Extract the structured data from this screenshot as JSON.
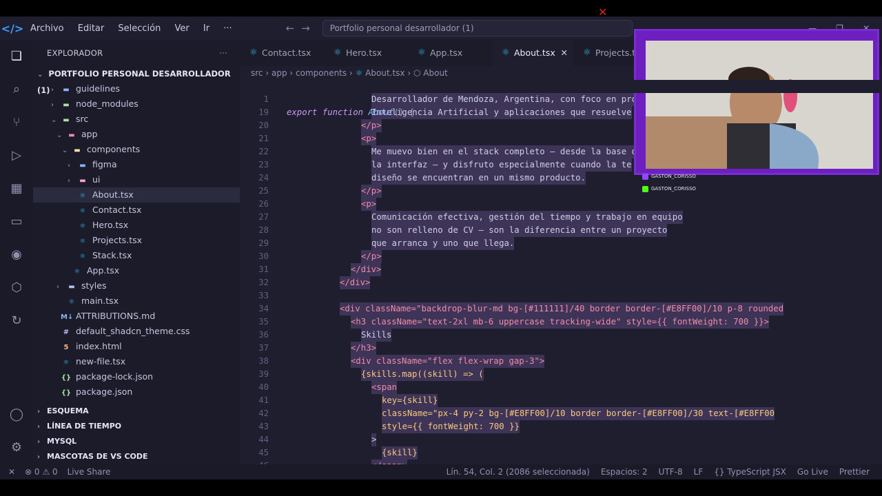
{
  "titlebar": {
    "menu": [
      "Archivo",
      "Editar",
      "Selección",
      "Ver",
      "Ir",
      "···"
    ],
    "search": "Portfolio personal desarrollador (1)",
    "record_icon": "✕"
  },
  "explorer": {
    "title": "EXPLORADOR",
    "project": "PORTFOLIO PERSONAL DESARROLLADOR (1)",
    "items": [
      {
        "label": "guidelines",
        "icon": "folder-icon",
        "color": "#89b4fa",
        "depth": 1,
        "chev": "›"
      },
      {
        "label": "node_modules",
        "icon": "folder-icon",
        "color": "#a6e3a1",
        "depth": 1,
        "chev": "›"
      },
      {
        "label": "src",
        "icon": "folder-open-icon",
        "color": "#a6e3a1",
        "depth": 1,
        "chev": "⌄"
      },
      {
        "label": "app",
        "icon": "folder-open-icon",
        "color": "#f38ba8",
        "depth": 2,
        "chev": "⌄"
      },
      {
        "label": "components",
        "icon": "folder-open-icon",
        "color": "#f9e2af",
        "depth": 3,
        "chev": "⌄"
      },
      {
        "label": "figma",
        "icon": "folder-icon",
        "color": "#89b4fa",
        "depth": 4,
        "chev": "›"
      },
      {
        "label": "ui",
        "icon": "folder-icon",
        "color": "#f5a3d4",
        "depth": 4,
        "chev": "›"
      },
      {
        "label": "About.tsx",
        "icon": "react-icon",
        "color": "#2fb5e0",
        "depth": 4,
        "chev": ""
      },
      {
        "label": "Contact.tsx",
        "icon": "react-icon",
        "color": "#2fb5e0",
        "depth": 4,
        "chev": ""
      },
      {
        "label": "Hero.tsx",
        "icon": "react-icon",
        "color": "#2fb5e0",
        "depth": 4,
        "chev": ""
      },
      {
        "label": "Projects.tsx",
        "icon": "react-icon",
        "color": "#2fb5e0",
        "depth": 4,
        "chev": ""
      },
      {
        "label": "Stack.tsx",
        "icon": "react-icon",
        "color": "#2fb5e0",
        "depth": 4,
        "chev": ""
      },
      {
        "label": "App.tsx",
        "icon": "react-icon",
        "color": "#2fb5e0",
        "depth": 3,
        "chev": ""
      },
      {
        "label": "styles",
        "icon": "folder-icon",
        "color": "#b4befe",
        "depth": 2,
        "chev": "›"
      },
      {
        "label": "main.tsx",
        "icon": "react-icon",
        "color": "#2fb5e0",
        "depth": 2,
        "chev": ""
      },
      {
        "label": "ATTRIBUTIONS.md",
        "icon": "markdown-icon",
        "color": "#89b4fa",
        "depth": 1,
        "chev": ""
      },
      {
        "label": "default_shadcn_theme.css",
        "icon": "css-icon",
        "color": "#b4befe",
        "depth": 1,
        "chev": ""
      },
      {
        "label": "index.html",
        "icon": "html-icon",
        "color": "#fab387",
        "depth": 1,
        "chev": ""
      },
      {
        "label": "new-file.tsx",
        "icon": "react-icon",
        "color": "#2fb5e0",
        "depth": 1,
        "chev": ""
      },
      {
        "label": "package-lock.json",
        "icon": "json-icon",
        "color": "#a6e3a1",
        "depth": 1,
        "chev": ""
      },
      {
        "label": "package.json",
        "icon": "json-icon",
        "color": "#a6e3a1",
        "depth": 1,
        "chev": ""
      }
    ],
    "selected": "About.tsx",
    "sections": [
      "ESQUEMA",
      "LÍNEA DE TIEMPO",
      "MYSQL",
      "MASCOTAS DE VS CODE"
    ]
  },
  "tabs": [
    {
      "label": "Contact.tsx",
      "active": false
    },
    {
      "label": "Hero.tsx",
      "active": false
    },
    {
      "label": "App.tsx",
      "active": false
    },
    {
      "label": "About.tsx",
      "active": true
    },
    {
      "label": "Projects.ts",
      "active": false
    }
  ],
  "breadcrumb": [
    "src",
    "app",
    "components",
    "About.tsx",
    "About"
  ],
  "sticky": {
    "ln": "1",
    "text": "export function About() {"
  },
  "code": [
    {
      "ln": "",
      "text": "Desarrollador de Mendoza, Argentina, con foco en pro"
    },
    {
      "ln": "19",
      "text": "Inteligencia Artificial y aplicaciones que resuelve"
    },
    {
      "ln": "20",
      "text": "</p>"
    },
    {
      "ln": "21",
      "text": "<p>"
    },
    {
      "ln": "22",
      "text": "Me muevo bien en el stack completo — desde la base d"
    },
    {
      "ln": "23",
      "text": "la interfaz — y disfruto especialmente cuando la te"
    },
    {
      "ln": "24",
      "text": "diseño se encuentran en un mismo producto."
    },
    {
      "ln": "25",
      "text": "</p>"
    },
    {
      "ln": "26",
      "text": "<p>"
    },
    {
      "ln": "27",
      "text": "Comunicación efectiva, gestión del tiempo y trabajo en equipo"
    },
    {
      "ln": "28",
      "text": "no son relleno de CV — son la diferencia entre un proyecto"
    },
    {
      "ln": "29",
      "text": "que arranca y uno que llega."
    },
    {
      "ln": "30",
      "text": "</p>"
    },
    {
      "ln": "31",
      "text": "</div>"
    },
    {
      "ln": "32",
      "text": "</div>"
    },
    {
      "ln": "33",
      "text": ""
    },
    {
      "ln": "34",
      "text": "<div className=\"backdrop-blur-md bg-[#111111]/40 border border-[#E8FF00]/10 p-8 rounded"
    },
    {
      "ln": "35",
      "text": "<h3 className=\"text-2xl mb-6 uppercase tracking-wide\" style={{ fontWeight: 700 }}>"
    },
    {
      "ln": "36",
      "text": "Skills"
    },
    {
      "ln": "37",
      "text": "</h3>"
    },
    {
      "ln": "38",
      "text": "<div className=\"flex flex-wrap gap-3\">"
    },
    {
      "ln": "39",
      "text": "{skills.map((skill) => ("
    },
    {
      "ln": "40",
      "text": "<span"
    },
    {
      "ln": "41",
      "text": "key={skill}"
    },
    {
      "ln": "42",
      "text": "className=\"px-4 py-2 bg-[#E8FF00]/10 border border-[#E8FF00]/30 text-[#E8FF00"
    },
    {
      "ln": "43",
      "text": "style={{ fontWeight: 700 }}"
    },
    {
      "ln": "44",
      "text": ">"
    },
    {
      "ln": "45",
      "text": "{skill}"
    },
    {
      "ln": "46",
      "text": "</span>"
    }
  ],
  "status": {
    "left": [
      "✕",
      "⊗ 0 ⚠ 0",
      "Live Share"
    ],
    "right": [
      "Lín. 54, Col. 2 (2086 seleccionada)",
      "Espacios: 2",
      "UTF-8",
      "LF",
      "{} TypeScript JSX",
      "Go Live",
      "Prettier"
    ]
  },
  "webcam": {
    "labels": [
      "GASTON_CORISSO",
      "GASTON_CORISSO"
    ]
  }
}
